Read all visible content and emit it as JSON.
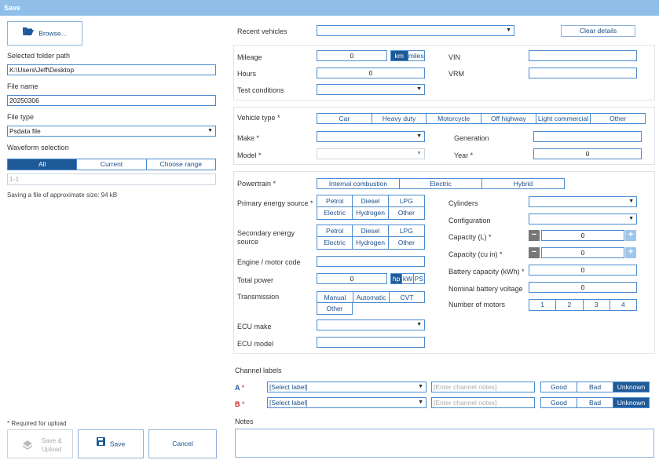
{
  "window": {
    "title": "Save"
  },
  "left": {
    "browse_label": "Browse...",
    "folder_label": "Selected folder path",
    "folder_value": "K:\\Users\\Jeff\\Desktop",
    "filename_label": "File name",
    "filename_value": "20250306",
    "filetype_label": "File type",
    "filetype_value": "Psdata file",
    "waveform_label": "Waveform selection",
    "waveform_options": [
      "All",
      "Current",
      "Choose range"
    ],
    "range_placeholder": "1-1",
    "size_note": "Saving a file of approximate size: 94 kB",
    "required_note": "* Required for upload",
    "save_upload_label_1": "Save &",
    "save_upload_label_2": "Upload",
    "save_label": "Save",
    "cancel_label": "Cancel"
  },
  "top": {
    "recent_label": "Recent vehicles",
    "clear_label": "Clear details"
  },
  "mileage": {
    "mileage_label": "Mileage",
    "mileage_value": "0",
    "units": [
      "km",
      "miles"
    ],
    "hours_label": "Hours",
    "hours_value": "0",
    "test_label": "Test conditions",
    "vin_label": "VIN",
    "vrm_label": "VRM"
  },
  "vehicle": {
    "type_label": "Vehicle type *",
    "types": [
      "Car",
      "Heavy duty",
      "Motorcycle",
      "Off highway",
      "Light commercial",
      "Other"
    ],
    "make_label": "Make *",
    "model_label": "Model *",
    "generation_label": "Generation",
    "year_label": "Year *",
    "year_value": "0"
  },
  "powertrain": {
    "label": "Powertrain *",
    "options": [
      "Internal combustion",
      "Electric",
      "Hybrid"
    ],
    "primary_label": "Primary energy source *",
    "secondary_label_1": "Secondary energy",
    "secondary_label_2": "source",
    "energy_options": [
      "Petrol",
      "Diesel",
      "LPG",
      "Electric",
      "Hydrogen",
      "Other"
    ],
    "engine_code_label": "Engine / motor code",
    "total_power_label": "Total power",
    "total_power_value": "0",
    "power_units": [
      "hp",
      "kW",
      "PS"
    ],
    "transmission_label": "Transmission",
    "transmission_options": [
      "Manual",
      "Automatic",
      "CVT",
      "Other"
    ],
    "ecu_make_label": "ECU make",
    "ecu_model_label": "ECU model",
    "cylinders_label": "Cylinders",
    "configuration_label": "Configuration",
    "capacity_l_label": "Capacity (L) *",
    "capacity_l_value": "0",
    "capacity_cuin_label": "Capacity (cu in) *",
    "capacity_cuin_value": "0",
    "battery_capacity_label": "Battery capacity (kWh) *",
    "battery_capacity_value": "0",
    "nominal_voltage_label": "Nominal battery voltage",
    "nominal_voltage_value": "0",
    "motors_label": "Number of motors",
    "motors_options": [
      "1",
      "2",
      "3",
      "4"
    ]
  },
  "channels": {
    "label": "Channel labels",
    "rows": [
      {
        "name": "A",
        "req": "*",
        "select": "[Select label]",
        "notes_placeholder": "[Enter channel notes]"
      },
      {
        "name": "B",
        "req": "*",
        "select": "[Select label]",
        "notes_placeholder": "[Enter channel notes]"
      }
    ],
    "quality_options": [
      "Good",
      "Bad",
      "Unknown"
    ]
  },
  "notes": {
    "label": "Notes"
  },
  "colors": {
    "titlebar": "#8fbfe9",
    "accent": "#1f5a98",
    "border": "#4a8bd1",
    "required": "#cc2222"
  }
}
